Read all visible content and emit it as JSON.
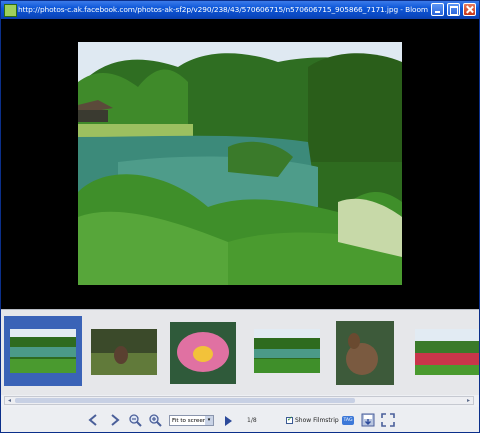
{
  "window": {
    "title": "http://photos-c.ak.facebook.com/photos-ak-sf2p/v290/238/43/570606715/n570606715_905866_7171.jpg - Bloom"
  },
  "filmstrip": {
    "thumbnails": [
      {
        "subject": "pond-garden",
        "selected": true
      },
      {
        "subject": "duck-on-grass",
        "selected": false
      },
      {
        "subject": "pink-water-lily",
        "selected": false
      },
      {
        "subject": "pond-garden",
        "selected": false
      },
      {
        "subject": "duck-closeup",
        "selected": false
      },
      {
        "subject": "flower-garden",
        "selected": false
      }
    ]
  },
  "toolbar": {
    "zoom_value": "Fit to screen",
    "counter": "1/8",
    "show_filmstrip_label": "Show Filmstrip",
    "show_filmstrip_checked": true,
    "badge": "TAG"
  },
  "colors": {
    "title_bar": "#0c56d8",
    "selection": "#3a63b7",
    "viewer_bg": "#000000"
  }
}
